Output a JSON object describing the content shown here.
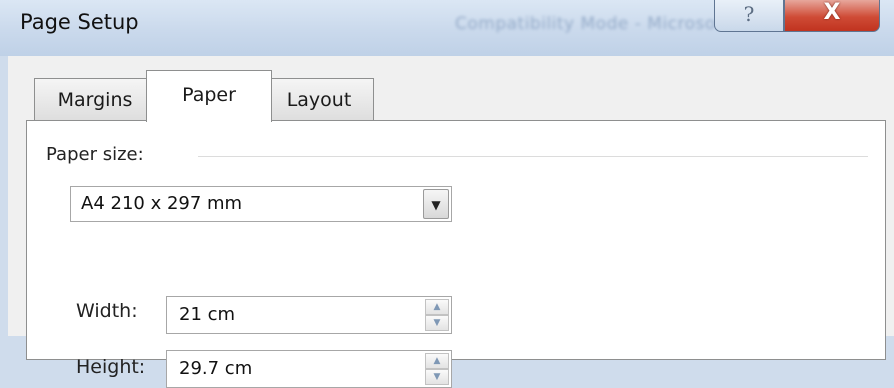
{
  "window": {
    "title": "Page Setup",
    "background_title": "Compatibility Mode - Microsoft Wo...",
    "help_glyph": "?",
    "close_glyph": "X"
  },
  "tabs": [
    {
      "label": "Margins",
      "active": false
    },
    {
      "label": "Paper",
      "active": true
    },
    {
      "label": "Layout",
      "active": false
    }
  ],
  "paper": {
    "group_label": "Paper size:",
    "size_select": {
      "value": "A4 210 x 297 mm",
      "arrow_icon": "▼"
    },
    "width": {
      "label": "Width:",
      "value": "21 cm"
    },
    "height": {
      "label": "Height:",
      "value": "29.7 cm"
    },
    "spin_up_icon": "▲",
    "spin_down_icon": "▼"
  },
  "colors": {
    "title_bar": "#cad9ec",
    "close_button": "#cf4b36",
    "panel": "#ffffff",
    "dialog": "#f0f0f0"
  }
}
